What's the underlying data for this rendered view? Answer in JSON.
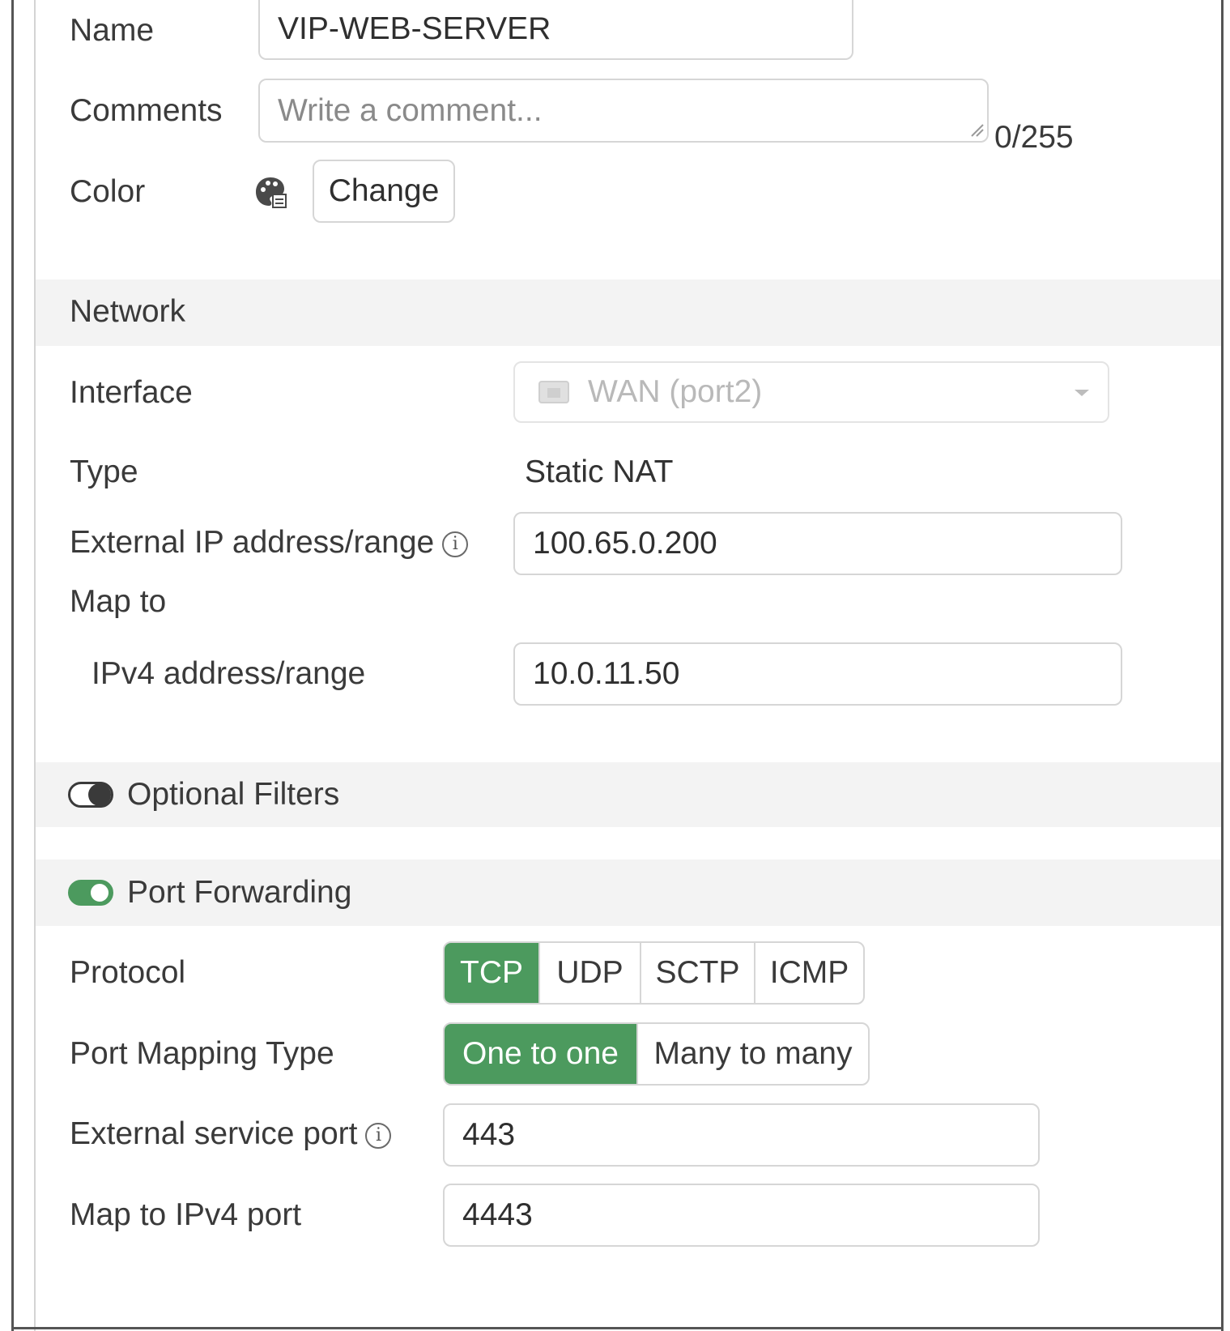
{
  "form": {
    "name_label": "Name",
    "name_value": "VIP-WEB-SERVER",
    "comments_label": "Comments",
    "comments_placeholder": "Write a comment...",
    "comments_counter": "0/255",
    "color_label": "Color",
    "color_change_button": "Change"
  },
  "network": {
    "section_title": "Network",
    "interface_label": "Interface",
    "interface_value": "WAN (port2)",
    "type_label": "Type",
    "type_value": "Static NAT",
    "external_ip_label": "External IP address/range",
    "external_ip_value": "100.65.0.200",
    "map_to_label": "Map to",
    "ipv4_label": "IPv4 address/range",
    "ipv4_value": "10.0.11.50"
  },
  "optional_filters": {
    "label": "Optional Filters",
    "enabled": false
  },
  "port_forwarding": {
    "label": "Port Forwarding",
    "enabled": true,
    "protocol_label": "Protocol",
    "protocols": [
      "TCP",
      "UDP",
      "SCTP",
      "ICMP"
    ],
    "selected_protocol": "TCP",
    "port_mapping_label": "Port Mapping Type",
    "port_mapping_options": [
      "One to one",
      "Many to many"
    ],
    "selected_port_mapping": "One to one",
    "external_port_label": "External service port",
    "external_port_value": "443",
    "map_port_label": "Map to IPv4 port",
    "map_port_value": "4443"
  },
  "colors": {
    "accent": "#4c9a5e",
    "section_background": "#f3f3f3",
    "border": "#d6d6d6"
  },
  "icons": {
    "color_swatch": "palette-icon",
    "interface": "network-port-icon",
    "info": "info-icon",
    "dropdown": "chevron-down-icon"
  }
}
